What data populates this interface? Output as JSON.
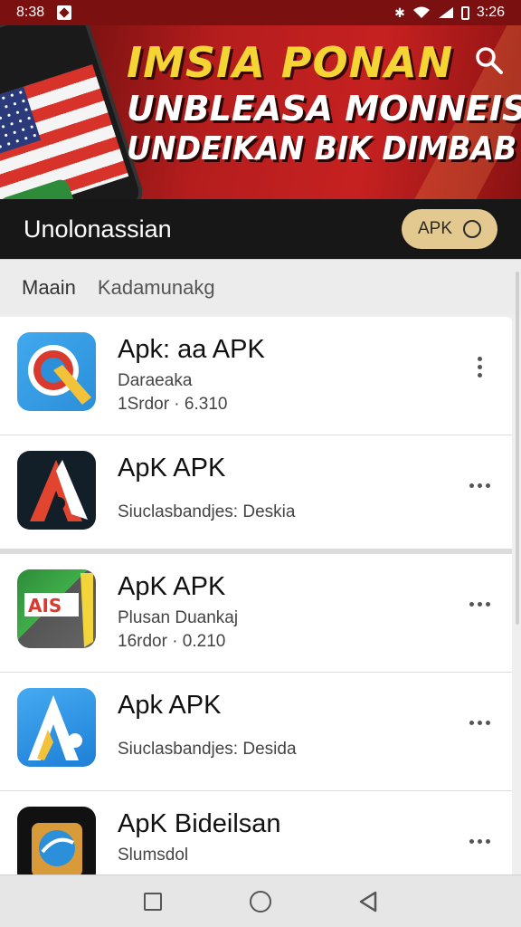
{
  "status_bar": {
    "time": "8:38",
    "clock_right": "3:26",
    "battery_level": 0.3
  },
  "banner": {
    "line1": "IMSIA PONAN",
    "line2": "UNBLEASA MONNEIS",
    "line3": "UNDEIKAN BIK DIMBAB"
  },
  "app_bar": {
    "title": "Unolonassian",
    "chip_label": "APK"
  },
  "tabs": [
    {
      "label": "Maain"
    },
    {
      "label": "Kadamunakg"
    }
  ],
  "apps": [
    {
      "title": "Apk: aa APK",
      "sub1": "Daraeaka",
      "sub2": "1Srdor · 6.310",
      "icon": "target-marker-icon"
    },
    {
      "title": "ApK APK",
      "sub1": "Siuclasbandjes: Deskia",
      "sub2": "",
      "icon": "letter-a-dark-icon"
    },
    {
      "title": "ApK APK",
      "sub1": "Plusan Duankaj",
      "sub2": "16rdor · 0.210",
      "icon": "ab-sign-icon"
    },
    {
      "title": "Apk APK",
      "sub1": "Siuclasbandjes: Desida",
      "sub2": "",
      "icon": "letter-a-blue-icon"
    },
    {
      "title": "ApK Bideilsan",
      "sub1": "Slumsdol",
      "sub2": "",
      "icon": "badge-icon"
    }
  ],
  "colors": {
    "banner_red": "#c62121",
    "banner_yellow": "#f5d533",
    "app_bar_bg": "#171717",
    "chip_bg": "#e3c98f"
  }
}
